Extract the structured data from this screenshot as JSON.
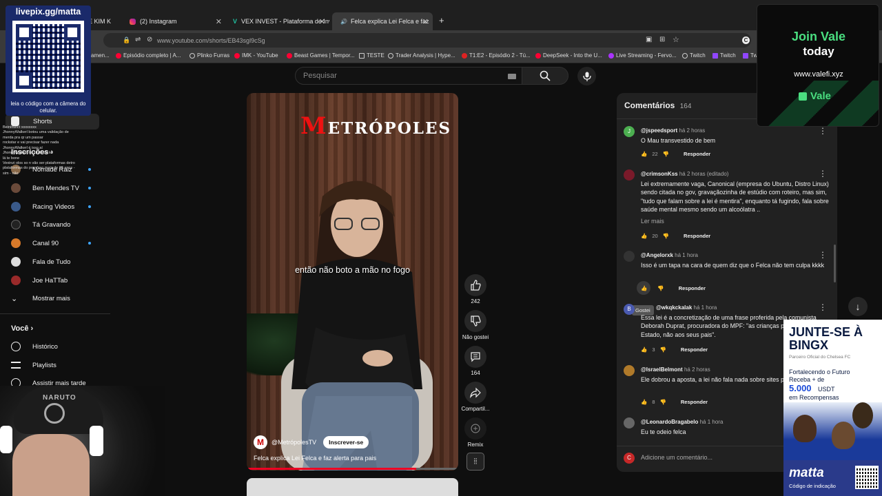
{
  "browser": {
    "tabs": [
      {
        "label": "E KIM K"
      },
      {
        "label": "(2) Instagram"
      },
      {
        "label": "VEX INVEST - Plataforma de Inv"
      },
      {
        "label": "Felca explica Lei Felca e faz"
      }
    ],
    "new_tab": "+",
    "url": "www.youtube.com/shorts/EB43sgl9cSg",
    "bookmarks": [
      "amen...",
      "Episódio completo | A...",
      "Plinko Furras",
      "IMK - YouTube",
      "Beast Games | Tempor...",
      "TESTE",
      "Trader Analysis | Hype...",
      "T1:E2 - Episódio 2 - Tú...",
      "DeepSeek - Into the U...",
      "Live Streaming - Fervo...",
      "Twitch",
      "Twitch",
      "Tw"
    ]
  },
  "search": {
    "placeholder": "Pesquisar"
  },
  "sidebar": {
    "shorts": "Shorts",
    "subscriptions_heading": "Inscrições",
    "channels": [
      {
        "name": "Nômade Raiz",
        "color": "#8a6a4a",
        "new": true
      },
      {
        "name": "Ben Mendes TV",
        "color": "#6a4a3a",
        "new": true
      },
      {
        "name": "Racing Videos",
        "color": "#3a5a8a",
        "new": true
      },
      {
        "name": "Tá Gravando",
        "color": "#222222",
        "new": false
      },
      {
        "name": "Canal 90",
        "color": "#d87a2a",
        "new": true
      },
      {
        "name": "Fala de Tudo",
        "color": "#dddddd",
        "new": false
      },
      {
        "name": "Joe HaTTab",
        "color": "#9a2a2a",
        "new": false
      }
    ],
    "show_more": "Mostrar mais",
    "you_heading": "Você",
    "you_items": [
      "Histórico",
      "Playlists",
      "Assistir mais tarde"
    ]
  },
  "video": {
    "brand": "METRÓPOLES",
    "brand_first": "M",
    "brand_rest": "ETRÓPOLES",
    "caption": "então não boto a mão no fogo",
    "channel": "@MetrópolesTV",
    "channel_initial": "M",
    "subscribe": "Inscrever-se",
    "title": "Felca explica Lei Felca e faz alerta para pais",
    "progress": 0.8
  },
  "actions": {
    "likes": "242",
    "dislike": "Não gostei",
    "comments": "164",
    "share": "Compartil...",
    "remix": "Remix"
  },
  "comments": {
    "title": "Comentários",
    "count": "164",
    "reply": "Responder",
    "more": "Ler mais",
    "tooltip": "Gostei",
    "add_placeholder": "Adicione um comentário...",
    "add_avatar": "C",
    "items": [
      {
        "user": "@jspeedsport",
        "time": "há 2 horas",
        "text": "O Mau transvestido de bem",
        "likes": "22",
        "avatar": "J",
        "color": "#4caf50"
      },
      {
        "user": "@crimsonKss",
        "time": "há 2 horas (editado)",
        "text": "Lei extremamente vaga, Canonical (empresa do Ubuntu, Distro Linux) sendo citada no gov, gravaçãozinha de estúdio com roteiro, mas sim, \"tudo que falam sobre a lei é mentira\", enquanto tá fugindo, fala sobre saúde mental mesmo sendo um alcoólatra ..",
        "likes": "20",
        "avatar": "",
        "color": "#7a1a2a"
      },
      {
        "user": "@Angelorxk",
        "time": "há 1 hora",
        "text": "Isso é um tapa na cara de quem diz que o Felca não tem culpa kkkk",
        "likes": "",
        "avatar": "",
        "color": "#333333"
      },
      {
        "user": "@wkqkckalak",
        "time": "há 1 hora",
        "text": "Essa lei é a concretização de uma frase proferida pela comunista Deborah Duprat, procuradora do MPF: \"as crianças pertencem ao Estado, não aos seus pais\".",
        "likes": "3",
        "avatar": "B",
        "color": "#4a5ab0"
      },
      {
        "user": "@IsraelBelmont",
        "time": "há 2 horas",
        "text": "Ele dobrou a aposta, a lei não fala nada sobre sites pornográficos!!!",
        "likes": "8",
        "avatar": "",
        "color": "#b07a2a"
      },
      {
        "user": "@LeonardoBragabelo",
        "time": "há 1 hora",
        "text": "Eu te odeio felca",
        "likes": "",
        "avatar": "",
        "color": "#666666"
      }
    ]
  },
  "overlays": {
    "qr_site": "livepix.gg/matta",
    "qr_caption": "leia o código com a câmera do celular.",
    "vale_line1": "Join Vale",
    "vale_line2": "today",
    "vale_site": "www.valefi.xyz",
    "vale_brand": "Vale",
    "bingx_title": "JUNTE-SE À BINGX",
    "bingx_sub": "Parceiro Oficial do Chelsea FC",
    "bingx_line1": "Fortalecendo o Futuro",
    "bingx_line2": "Receba + de",
    "bingx_amount": "5.000",
    "bingx_unit": "USDT",
    "bingx_line3": "em Recompensas",
    "matta_brand": "matta",
    "matta_sub": "Código de indicação",
    "webcam_cap_text": "NARUTO",
    "chat_lines": [
      "Beinintinct xxxxxxxx",
      "JhonnyWalkerl botou uma validação de merda pra qr um passar",
      "rockstar e vai precisar fazer nada",
      "JhonnyWalkerl é isso aí",
      "JhonnyWalkerl no limite da lei",
      "lá te bone",
      "Vexinzi olos so n vão ser plataformas detro",
      "plataformas do pornô so mais de 18 anos - sim - não"
    ]
  },
  "colors": {
    "accent": "#3ea6ff",
    "red": "#ff0033",
    "panel": "#212121"
  }
}
